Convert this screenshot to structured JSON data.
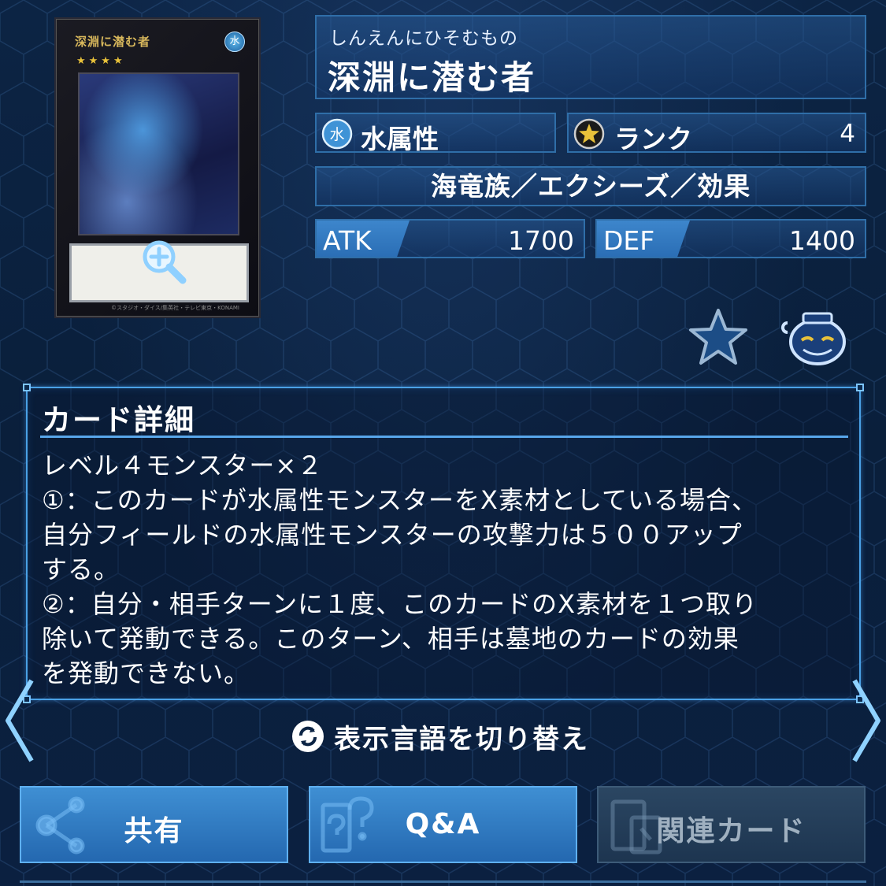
{
  "card": {
    "name_reading": "しんえんにひそむもの",
    "name": "深淵に潜む者",
    "image_name_text": "深淵に潜む者",
    "image_attr_glyph": "水",
    "image_stars": "★★★★",
    "image_copyright": "©スタジオ・ダイス/集英社・テレビ東京・KONAMI",
    "attribute_label": "水属性",
    "attribute_glyph": "水",
    "rank_label": "ランク",
    "rank_value": "4",
    "type_line": "海竜族／エクシーズ／効果",
    "atk_label": "ATK",
    "atk_value": "1700",
    "def_label": "DEF",
    "def_value": "1400"
  },
  "details": {
    "title": "カード詳細",
    "text": "レベル４モンスター×２\n①：このカードが水属性モンスターをX素材としている場合、\n自分フィールドの水属性モンスターの攻撃力は５００アップ\nする。\n②：自分・相手ターンに１度、このカードのX素材を１つ取り\n除いて発動できる。このターン、相手は墓地のカードの効果\nを発動できない。"
  },
  "language_toggle": {
    "label": "表示言語を切り替え"
  },
  "buttons": {
    "share": "共有",
    "qa": "Q&A",
    "related": "関連カード"
  },
  "icons": {
    "zoom": "zoom-in-icon",
    "favorite": "star-icon",
    "pot": "pot-of-greed-icon",
    "language": "refresh-icon",
    "share": "share-icon",
    "qa": "question-icon",
    "related": "related-cards-icon"
  },
  "colors": {
    "background": "#0b2040",
    "panel_border": "#2f6ea8",
    "accent": "#3d86cc",
    "details_border": "#4aa1e6",
    "button_active": "#2f7cc4",
    "button_disabled": "#243d59"
  }
}
